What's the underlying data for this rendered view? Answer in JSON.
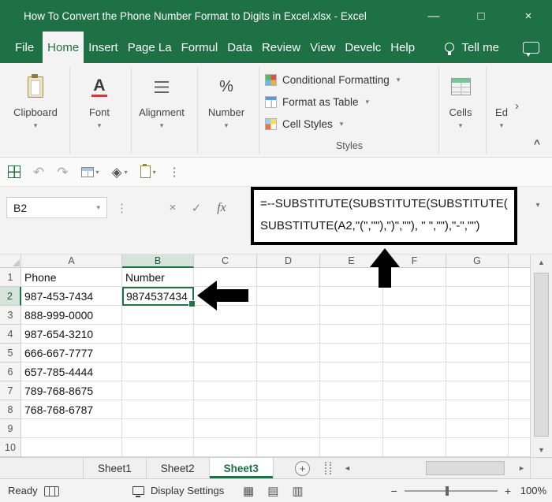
{
  "window": {
    "title": "How To Convert the Phone Number Format to Digits in Excel.xlsx - Excel"
  },
  "colors": {
    "titlebar_green": "#1e7145",
    "accent_green": "#217346",
    "annotation_black": "#000000"
  },
  "icons": {
    "minimize": "—",
    "maximize": "□",
    "close": "×",
    "chevron_down": "▾",
    "chevron_up": "^",
    "chevron_right": "›",
    "undo": "↶",
    "redo": "↷",
    "diamond": "◈",
    "dots_vertical": "⋮",
    "cancel": "×",
    "check": "✓",
    "arrow_up_small": "▲",
    "arrow_down_small": "▼",
    "arrow_left_small": "◄",
    "arrow_right_small": "►",
    "plus": "+",
    "minus": "−",
    "percent": "%",
    "font_letter": "A",
    "view_normal": "▦",
    "view_layout": "▤",
    "view_break": "▥"
  },
  "menu": {
    "tabs": [
      {
        "label": "File"
      },
      {
        "label": "Home"
      },
      {
        "label": "Insert"
      },
      {
        "label": "Page La"
      },
      {
        "label": "Formul"
      },
      {
        "label": "Data"
      },
      {
        "label": "Review"
      },
      {
        "label": "View"
      },
      {
        "label": "Develc"
      },
      {
        "label": "Help"
      }
    ],
    "tell_me": "Tell me"
  },
  "ribbon": {
    "groups": [
      {
        "label": "Clipboard"
      },
      {
        "label": "Font"
      },
      {
        "label": "Alignment"
      },
      {
        "label": "Number"
      }
    ],
    "styles": {
      "label": "Styles",
      "items": [
        {
          "label": "Conditional Formatting"
        },
        {
          "label": "Format as Table"
        },
        {
          "label": "Cell Styles"
        }
      ]
    },
    "cells": {
      "label": "Cells"
    },
    "editing": {
      "label": "Ed"
    }
  },
  "formula_bar": {
    "name_box": "B2",
    "fx": "fx",
    "formula_line1": "=--SUBSTITUTE(SUBSTITUTE(SUBSTITUTE(",
    "formula_line2": "SUBSTITUTE(A2,\"(\",\"\"),\")\",\"\"), \" \",\"\"),\"-\",\"\")"
  },
  "grid": {
    "selected_cell": "B2",
    "columns": [
      "A",
      "B",
      "C",
      "D",
      "E",
      "F",
      "G"
    ],
    "rows": [
      {
        "n": "1",
        "c": [
          "Phone",
          "Number",
          "",
          "",
          "",
          "",
          ""
        ]
      },
      {
        "n": "2",
        "c": [
          "987-453-7434",
          "9874537434",
          "",
          "",
          "",
          "",
          ""
        ]
      },
      {
        "n": "3",
        "c": [
          "888-999-0000",
          "",
          "",
          "",
          "",
          "",
          ""
        ]
      },
      {
        "n": "4",
        "c": [
          "987-654-3210",
          "",
          "",
          "",
          "",
          "",
          ""
        ]
      },
      {
        "n": "5",
        "c": [
          "666-667-7777",
          "",
          "",
          "",
          "",
          "",
          ""
        ]
      },
      {
        "n": "6",
        "c": [
          "657-785-4444",
          "",
          "",
          "",
          "",
          "",
          ""
        ]
      },
      {
        "n": "7",
        "c": [
          "789-768-8675",
          "",
          "",
          "",
          "",
          "",
          ""
        ]
      },
      {
        "n": "8",
        "c": [
          "768-768-6787",
          "",
          "",
          "",
          "",
          "",
          ""
        ]
      },
      {
        "n": "9",
        "c": [
          "",
          "",
          "",
          "",
          "",
          "",
          ""
        ]
      },
      {
        "n": "10",
        "c": [
          "",
          "",
          "",
          "",
          "",
          "",
          ""
        ]
      }
    ]
  },
  "sheets": {
    "tabs": [
      {
        "label": "Sheet1"
      },
      {
        "label": "Sheet2"
      },
      {
        "label": "Sheet3"
      }
    ],
    "active": "Sheet3"
  },
  "status_bar": {
    "mode": "Ready",
    "display_settings": "Display Settings",
    "zoom_level": "100%"
  }
}
